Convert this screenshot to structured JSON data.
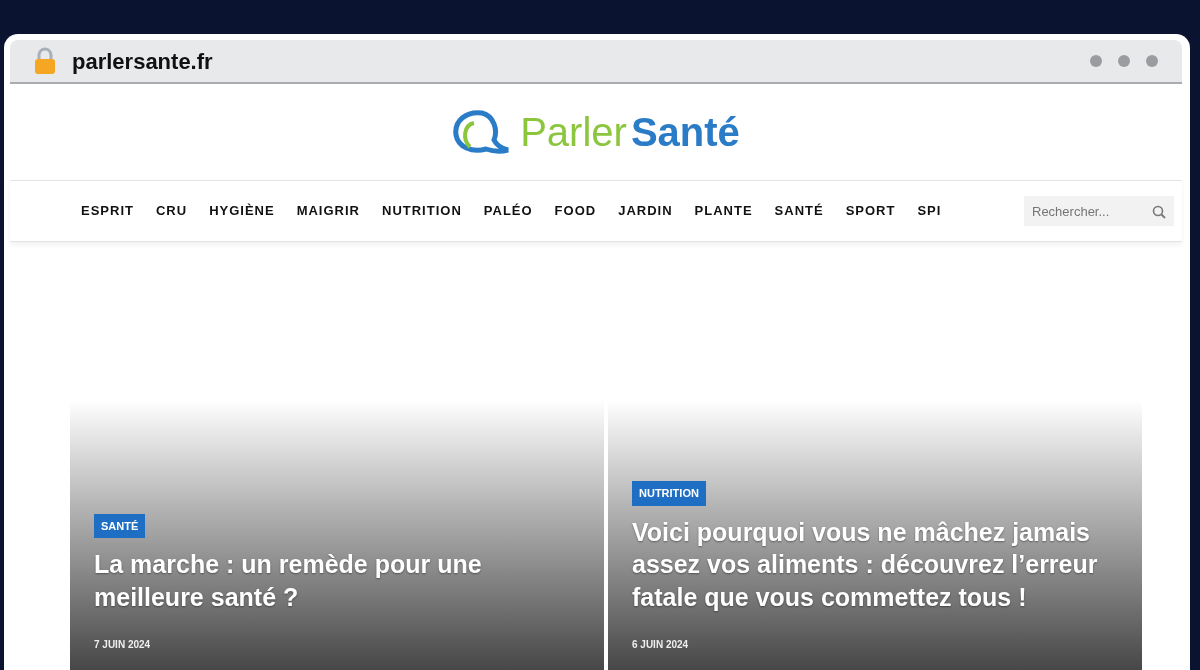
{
  "browser": {
    "url": "parlersante.fr"
  },
  "logo": {
    "first": "Parler",
    "second": "Santé"
  },
  "nav": {
    "items": [
      "ESPRIT",
      "CRU",
      "HYGIÈNE",
      "MAIGRIR",
      "NUTRITION",
      "PALÉO",
      "FOOD",
      "JARDIN",
      "PLANTE",
      "SANTÉ",
      "SPORT",
      "SPI"
    ],
    "search": {
      "placeholder": "Rechercher..."
    }
  },
  "articles": [
    {
      "category": "SANTÉ",
      "title": "La marche : un remède pour une meilleure santé ?",
      "date": "7 JUIN 2024"
    },
    {
      "category": "NUTRITION",
      "title": "Voici pourquoi vous ne mâchez jamais assez vos aliments : découvrez l’erreur fatale que vous commettez tous !",
      "date": "6 JUIN 2024"
    }
  ]
}
